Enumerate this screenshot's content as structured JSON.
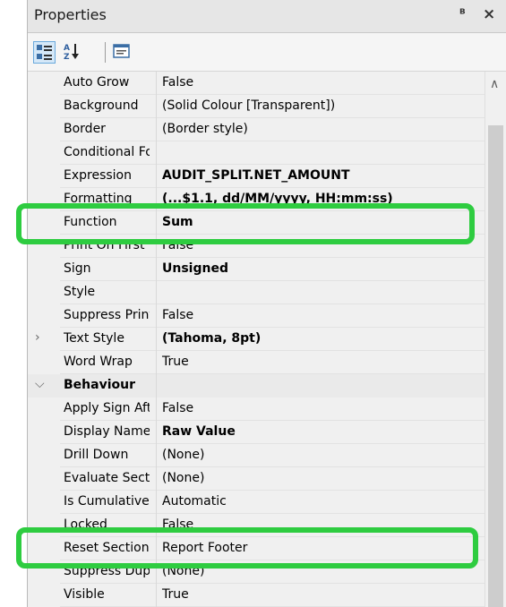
{
  "panel": {
    "title": "Properties",
    "pin_glyph": "❀",
    "close_glyph": "×"
  },
  "toolbar": {
    "categorized_icon": "categorized-view-icon",
    "alphabetical_label": "A↓Z",
    "property_pages_icon": "property-pages-icon"
  },
  "rows": [
    {
      "name": "Auto Grow",
      "value": "False",
      "bold": false
    },
    {
      "name": "Background",
      "value": "(Solid Colour [Transparent])",
      "bold": false
    },
    {
      "name": "Border",
      "value": "(Border style)",
      "bold": false
    },
    {
      "name": "Conditional Fo",
      "value": "",
      "bold": false
    },
    {
      "name": "Expression",
      "value": "AUDIT_SPLIT.NET_AMOUNT",
      "bold": true
    },
    {
      "name": "Formatting",
      "value": "(...$1.1, dd/MM/yyyy, HH:mm:ss)",
      "bold": true
    },
    {
      "name": "Function",
      "value": "Sum",
      "bold": true
    },
    {
      "name": "Print On First",
      "value": "False",
      "bold": false
    },
    {
      "name": "Sign",
      "value": "Unsigned",
      "bold": true
    },
    {
      "name": "Style",
      "value": "",
      "bold": false
    },
    {
      "name": "Suppress Print",
      "value": "False",
      "bold": false
    },
    {
      "name": "Text Style",
      "value": "(Tahoma, 8pt)",
      "bold": true
    },
    {
      "name": "Word Wrap",
      "value": "True",
      "bold": false
    },
    {
      "name": "Behaviour",
      "value": "",
      "bold": true
    },
    {
      "name": "Apply Sign Aft",
      "value": "False",
      "bold": false
    },
    {
      "name": "Display Namec",
      "value": "Raw Value",
      "bold": true
    },
    {
      "name": "Drill Down",
      "value": "(None)",
      "bold": false
    },
    {
      "name": "Evaluate Secti",
      "value": "(None)",
      "bold": false
    },
    {
      "name": "Is Cumulative",
      "value": "Automatic",
      "bold": false
    },
    {
      "name": "Locked",
      "value": "False",
      "bold": false
    },
    {
      "name": "Reset Section",
      "value": "Report Footer",
      "bold": false
    },
    {
      "name": "Suppress Dupl",
      "value": "(None)",
      "bold": false
    },
    {
      "name": "Visible",
      "value": "True",
      "bold": false
    }
  ],
  "highlight_color": "#2ecc40",
  "expand_glyph": "›",
  "collapse_glyph": "⌄",
  "scroll_up_glyph": "‸"
}
